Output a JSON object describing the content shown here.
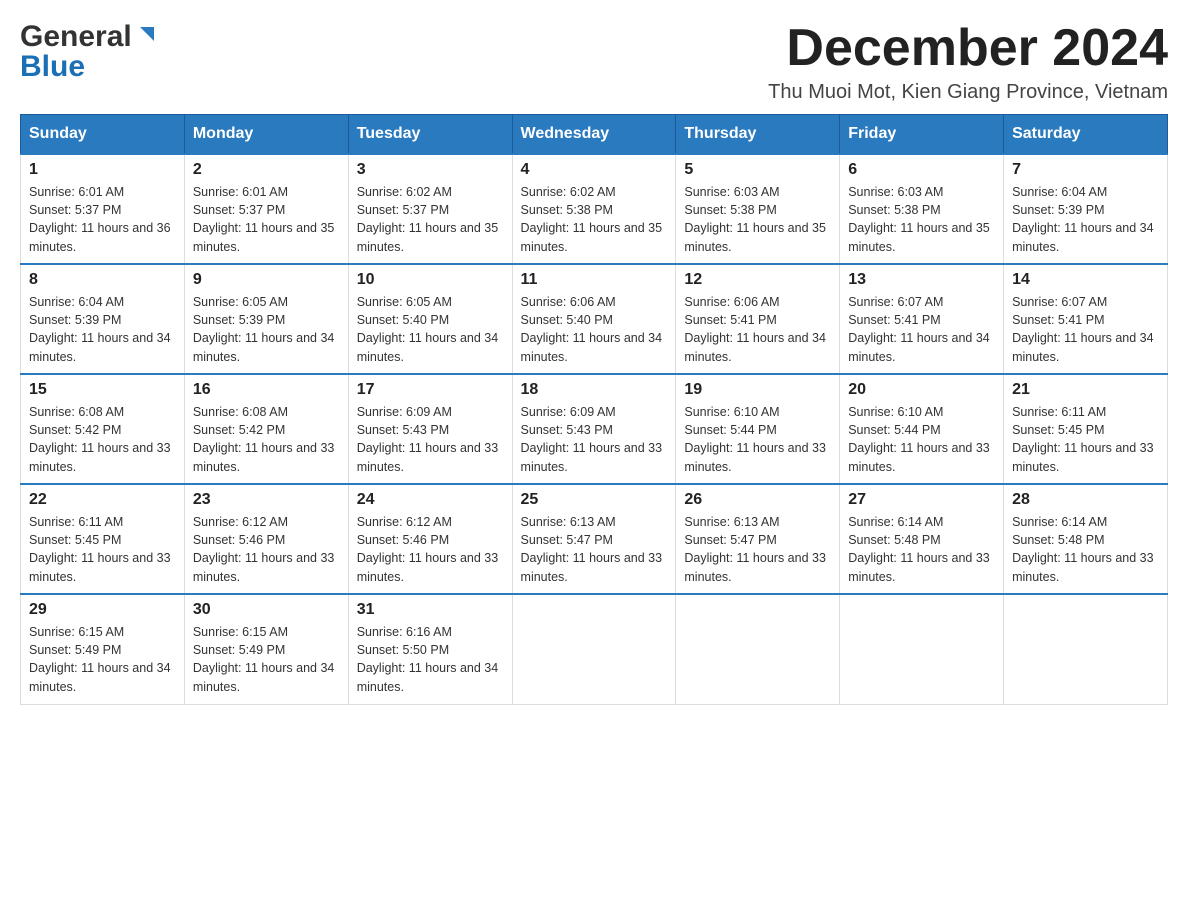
{
  "header": {
    "logo_general": "General",
    "logo_blue": "Blue",
    "month_title": "December 2024",
    "location": "Thu Muoi Mot, Kien Giang Province, Vietnam"
  },
  "weekdays": [
    "Sunday",
    "Monday",
    "Tuesday",
    "Wednesday",
    "Thursday",
    "Friday",
    "Saturday"
  ],
  "weeks": [
    [
      {
        "day": "1",
        "sunrise": "6:01 AM",
        "sunset": "5:37 PM",
        "daylight": "11 hours and 36 minutes."
      },
      {
        "day": "2",
        "sunrise": "6:01 AM",
        "sunset": "5:37 PM",
        "daylight": "11 hours and 35 minutes."
      },
      {
        "day": "3",
        "sunrise": "6:02 AM",
        "sunset": "5:37 PM",
        "daylight": "11 hours and 35 minutes."
      },
      {
        "day": "4",
        "sunrise": "6:02 AM",
        "sunset": "5:38 PM",
        "daylight": "11 hours and 35 minutes."
      },
      {
        "day": "5",
        "sunrise": "6:03 AM",
        "sunset": "5:38 PM",
        "daylight": "11 hours and 35 minutes."
      },
      {
        "day": "6",
        "sunrise": "6:03 AM",
        "sunset": "5:38 PM",
        "daylight": "11 hours and 35 minutes."
      },
      {
        "day": "7",
        "sunrise": "6:04 AM",
        "sunset": "5:39 PM",
        "daylight": "11 hours and 34 minutes."
      }
    ],
    [
      {
        "day": "8",
        "sunrise": "6:04 AM",
        "sunset": "5:39 PM",
        "daylight": "11 hours and 34 minutes."
      },
      {
        "day": "9",
        "sunrise": "6:05 AM",
        "sunset": "5:39 PM",
        "daylight": "11 hours and 34 minutes."
      },
      {
        "day": "10",
        "sunrise": "6:05 AM",
        "sunset": "5:40 PM",
        "daylight": "11 hours and 34 minutes."
      },
      {
        "day": "11",
        "sunrise": "6:06 AM",
        "sunset": "5:40 PM",
        "daylight": "11 hours and 34 minutes."
      },
      {
        "day": "12",
        "sunrise": "6:06 AM",
        "sunset": "5:41 PM",
        "daylight": "11 hours and 34 minutes."
      },
      {
        "day": "13",
        "sunrise": "6:07 AM",
        "sunset": "5:41 PM",
        "daylight": "11 hours and 34 minutes."
      },
      {
        "day": "14",
        "sunrise": "6:07 AM",
        "sunset": "5:41 PM",
        "daylight": "11 hours and 34 minutes."
      }
    ],
    [
      {
        "day": "15",
        "sunrise": "6:08 AM",
        "sunset": "5:42 PM",
        "daylight": "11 hours and 33 minutes."
      },
      {
        "day": "16",
        "sunrise": "6:08 AM",
        "sunset": "5:42 PM",
        "daylight": "11 hours and 33 minutes."
      },
      {
        "day": "17",
        "sunrise": "6:09 AM",
        "sunset": "5:43 PM",
        "daylight": "11 hours and 33 minutes."
      },
      {
        "day": "18",
        "sunrise": "6:09 AM",
        "sunset": "5:43 PM",
        "daylight": "11 hours and 33 minutes."
      },
      {
        "day": "19",
        "sunrise": "6:10 AM",
        "sunset": "5:44 PM",
        "daylight": "11 hours and 33 minutes."
      },
      {
        "day": "20",
        "sunrise": "6:10 AM",
        "sunset": "5:44 PM",
        "daylight": "11 hours and 33 minutes."
      },
      {
        "day": "21",
        "sunrise": "6:11 AM",
        "sunset": "5:45 PM",
        "daylight": "11 hours and 33 minutes."
      }
    ],
    [
      {
        "day": "22",
        "sunrise": "6:11 AM",
        "sunset": "5:45 PM",
        "daylight": "11 hours and 33 minutes."
      },
      {
        "day": "23",
        "sunrise": "6:12 AM",
        "sunset": "5:46 PM",
        "daylight": "11 hours and 33 minutes."
      },
      {
        "day": "24",
        "sunrise": "6:12 AM",
        "sunset": "5:46 PM",
        "daylight": "11 hours and 33 minutes."
      },
      {
        "day": "25",
        "sunrise": "6:13 AM",
        "sunset": "5:47 PM",
        "daylight": "11 hours and 33 minutes."
      },
      {
        "day": "26",
        "sunrise": "6:13 AM",
        "sunset": "5:47 PM",
        "daylight": "11 hours and 33 minutes."
      },
      {
        "day": "27",
        "sunrise": "6:14 AM",
        "sunset": "5:48 PM",
        "daylight": "11 hours and 33 minutes."
      },
      {
        "day": "28",
        "sunrise": "6:14 AM",
        "sunset": "5:48 PM",
        "daylight": "11 hours and 33 minutes."
      }
    ],
    [
      {
        "day": "29",
        "sunrise": "6:15 AM",
        "sunset": "5:49 PM",
        "daylight": "11 hours and 34 minutes."
      },
      {
        "day": "30",
        "sunrise": "6:15 AM",
        "sunset": "5:49 PM",
        "daylight": "11 hours and 34 minutes."
      },
      {
        "day": "31",
        "sunrise": "6:16 AM",
        "sunset": "5:50 PM",
        "daylight": "11 hours and 34 minutes."
      },
      null,
      null,
      null,
      null
    ]
  ]
}
